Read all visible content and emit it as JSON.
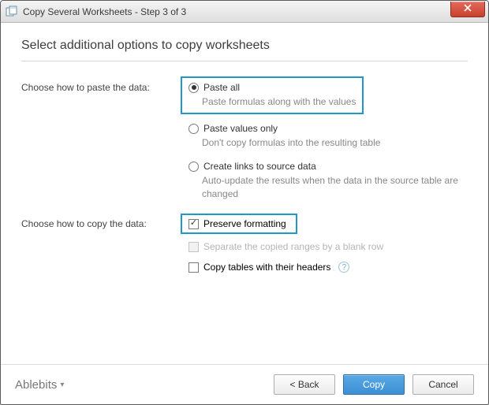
{
  "window": {
    "title": "Copy Several Worksheets - Step 3 of 3"
  },
  "heading": "Select additional options to copy worksheets",
  "paste": {
    "label": "Choose how to paste the data:",
    "options": [
      {
        "label": "Paste all",
        "desc": "Paste formulas along with the values"
      },
      {
        "label": "Paste values only",
        "desc": "Don't copy formulas into the resulting table"
      },
      {
        "label": "Create links to source data",
        "desc": "Auto-update the results when the data in the source table are changed"
      }
    ]
  },
  "copy": {
    "label": "Choose how to copy the data:",
    "checks": [
      {
        "label": "Preserve formatting"
      },
      {
        "label": "Separate the copied ranges by a blank row"
      },
      {
        "label": "Copy tables with their headers"
      }
    ]
  },
  "footer": {
    "brand": "Ablebits",
    "back": "< Back",
    "copy": "Copy",
    "cancel": "Cancel"
  }
}
